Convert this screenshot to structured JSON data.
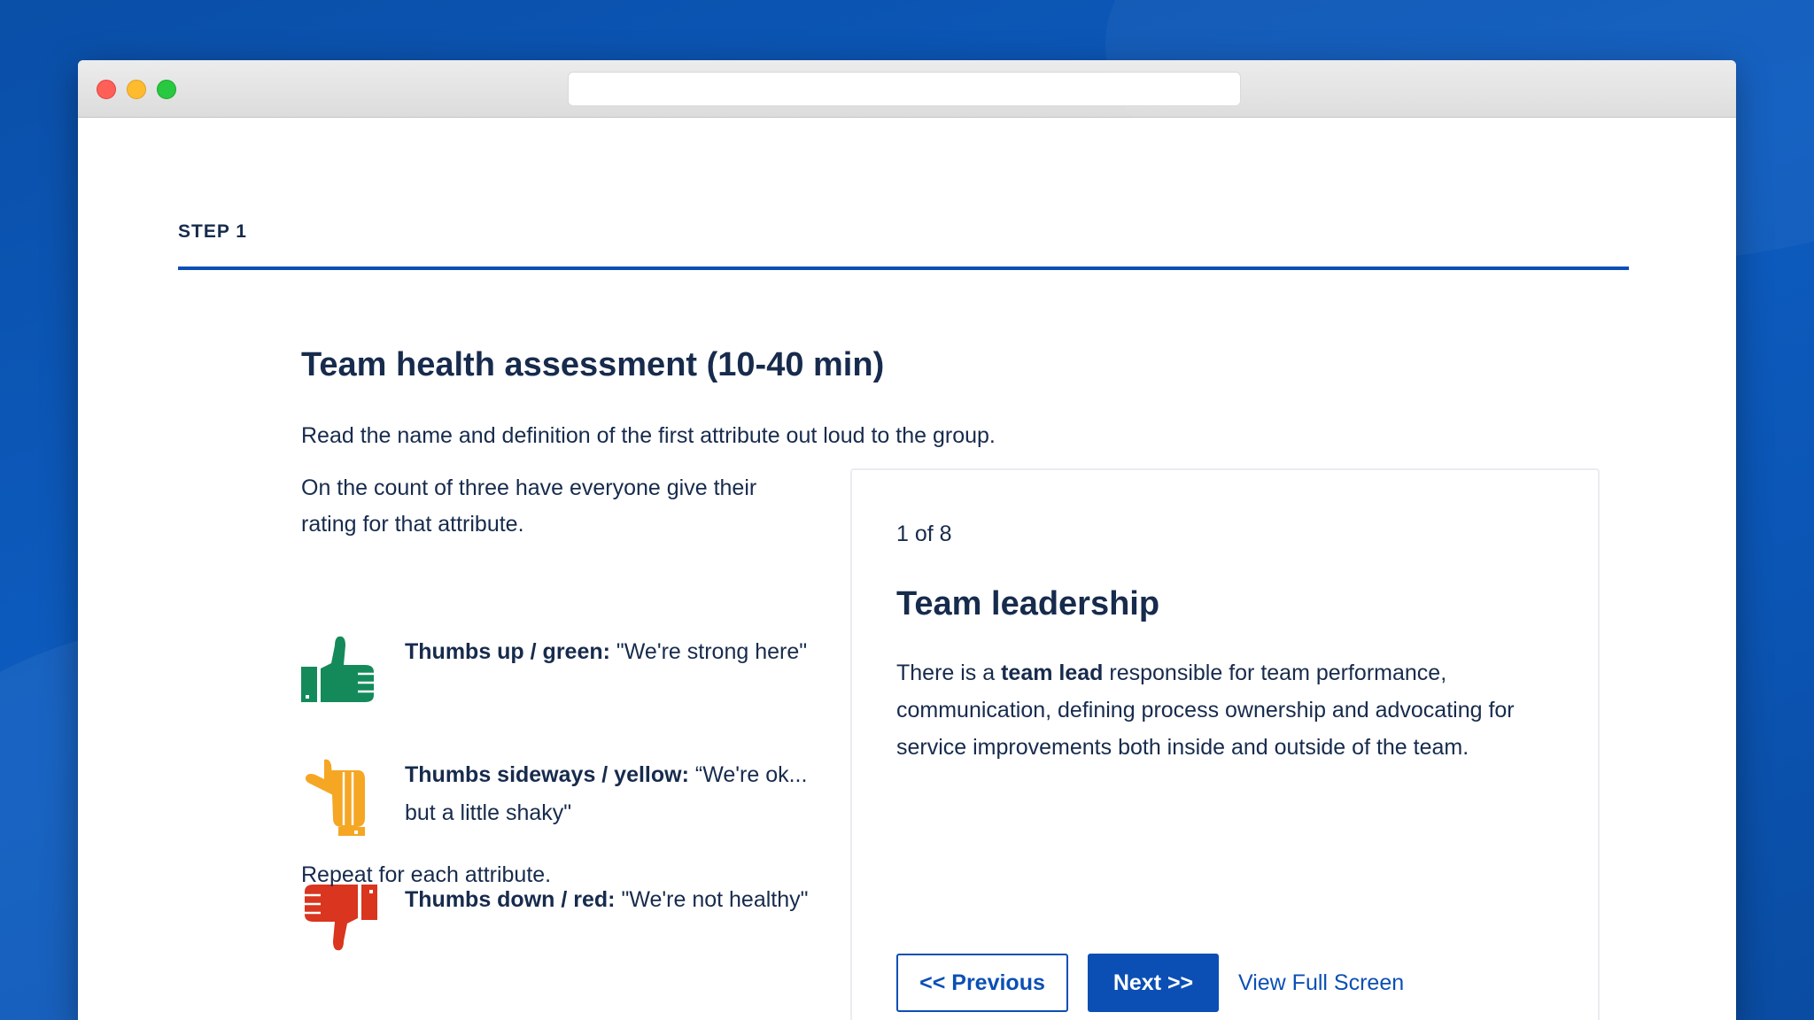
{
  "step": {
    "label": "STEP 1"
  },
  "intro": {
    "title": "Team health assessment (10-40 min)",
    "instruction": "Read the name and definition of the first attribute out loud to the group.",
    "count_instruction": "On the count of three have everyone give their rating for that attribute.",
    "repeat": "Repeat for each attribute."
  },
  "ratings": [
    {
      "icon": "thumbs-up-icon",
      "label": "Thumbs up / green:",
      "description": " \"We're strong here\"",
      "color": "#148a5a"
    },
    {
      "icon": "thumbs-sideways-icon",
      "label": "Thumbs sideways / yellow:",
      "description": " “We're ok... but a little shaky\"",
      "color": "#f5a623"
    },
    {
      "icon": "thumbs-down-icon",
      "label": "Thumbs down / red:",
      "description": " \"We're not healthy\"",
      "color": "#d9351f"
    }
  ],
  "card": {
    "counter": "1 of 8",
    "title": "Team leadership",
    "body_prefix": "There is a ",
    "body_bold": "team lead",
    "body_suffix": " responsible for team performance, communication, defining process ownership and advocating for service improvements both inside and outside of the team.",
    "prev_label": "<< Previous",
    "next_label": "Next >>",
    "fullscreen_label": "View Full Screen"
  },
  "theme": {
    "accent": "#0b4fb5",
    "text": "#172b4d"
  }
}
